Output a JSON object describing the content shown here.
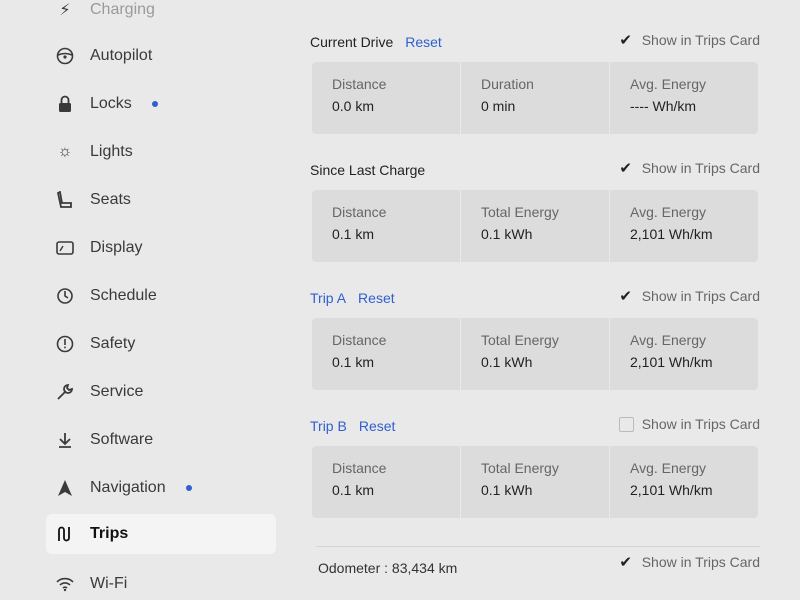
{
  "sidebar": {
    "items": [
      {
        "label": "Charging",
        "icon": "charging-icon",
        "dot": false
      },
      {
        "label": "Autopilot",
        "icon": "steering-wheel-icon",
        "dot": false
      },
      {
        "label": "Locks",
        "icon": "lock-icon",
        "dot": true
      },
      {
        "label": "Lights",
        "icon": "light-icon",
        "dot": false
      },
      {
        "label": "Seats",
        "icon": "seat-icon",
        "dot": false
      },
      {
        "label": "Display",
        "icon": "display-icon",
        "dot": false
      },
      {
        "label": "Schedule",
        "icon": "schedule-icon",
        "dot": false
      },
      {
        "label": "Safety",
        "icon": "safety-icon",
        "dot": false
      },
      {
        "label": "Service",
        "icon": "wrench-icon",
        "dot": false
      },
      {
        "label": "Software",
        "icon": "download-icon",
        "dot": false
      },
      {
        "label": "Navigation",
        "icon": "navigation-icon",
        "dot": true
      },
      {
        "label": "Trips",
        "icon": "trips-icon",
        "dot": false
      },
      {
        "label": "Wi-Fi",
        "icon": "wifi-icon",
        "dot": false
      }
    ]
  },
  "sections": {
    "current_drive": {
      "title": "Current Drive",
      "reset": "Reset",
      "show_label": "Show in Trips Card",
      "checked": true,
      "cells": [
        {
          "label": "Distance",
          "value": "0.0 km"
        },
        {
          "label": "Duration",
          "value": "0 min"
        },
        {
          "label": "Avg. Energy",
          "value": "---- Wh/km"
        }
      ]
    },
    "since_last_charge": {
      "title": "Since Last Charge",
      "show_label": "Show in Trips Card",
      "checked": true,
      "cells": [
        {
          "label": "Distance",
          "value": "0.1 km"
        },
        {
          "label": "Total Energy",
          "value": "0.1 kWh"
        },
        {
          "label": "Avg. Energy",
          "value": "2,101 Wh/km"
        }
      ]
    },
    "trip_a": {
      "title": "Trip A",
      "reset": "Reset",
      "show_label": "Show in Trips Card",
      "checked": true,
      "cells": [
        {
          "label": "Distance",
          "value": "0.1 km"
        },
        {
          "label": "Total Energy",
          "value": "0.1 kWh"
        },
        {
          "label": "Avg. Energy",
          "value": "2,101 Wh/km"
        }
      ]
    },
    "trip_b": {
      "title": "Trip B",
      "reset": "Reset",
      "show_label": "Show in Trips Card",
      "checked": false,
      "cells": [
        {
          "label": "Distance",
          "value": "0.1 km"
        },
        {
          "label": "Total Energy",
          "value": "0.1 kWh"
        },
        {
          "label": "Avg. Energy",
          "value": "2,101 Wh/km"
        }
      ]
    },
    "odometer": {
      "label": "Odometer",
      "separator": ":",
      "value": "83,434 km",
      "show_label": "Show in Trips Card",
      "checked": true
    }
  },
  "colors": {
    "accent": "#2f5fd0",
    "background": "#e9e9e9",
    "card": "#dcdcdc"
  }
}
